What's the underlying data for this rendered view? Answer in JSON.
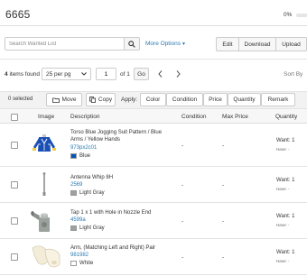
{
  "header": {
    "title": "6665",
    "progress_label": "0%",
    "progress_fraction": 0
  },
  "search": {
    "placeholder": "Search Wanted List",
    "more_options_label": "More Options"
  },
  "actions": {
    "edit_label": "Edit",
    "download_label": "Download",
    "upload_label": "Upload"
  },
  "pagination": {
    "items_found_count": "4",
    "items_found_text": "items found",
    "per_page_label": "25 per pg",
    "page_value": "1",
    "of_pages_label": "of 1",
    "go_label": "Go",
    "sort_by_label": "Sort By"
  },
  "toolbar": {
    "selected_label": "0 selected",
    "move_label": "Move",
    "copy_label": "Copy",
    "apply_label": "Apply:",
    "color_label": "Color",
    "condition_label": "Condition",
    "price_label": "Price",
    "quantity_label": "Quantity",
    "remark_label": "Remark"
  },
  "table": {
    "headers": {
      "image": "Image",
      "description": "Description",
      "condition": "Condition",
      "max_price": "Max Price",
      "quantity": "Quantity"
    },
    "rows": [
      {
        "description": "Torso Blue Jogging Suit Pattern / Blue Arms / Yellow Hands",
        "item_no": "973px2c01",
        "color_name": "Blue",
        "color_hex": "#0055bf",
        "condition": "-",
        "max_price": "-",
        "want": "Want: 1",
        "have": "Have: -",
        "image_icon": "torso-icon"
      },
      {
        "description": "Antenna Whip 8H",
        "item_no": "2569",
        "color_name": "Light Gray",
        "color_hex": "#9ba19d",
        "condition": "-",
        "max_price": "-",
        "want": "Want: 1",
        "have": "Have: -",
        "image_icon": "antenna-icon"
      },
      {
        "description": "Tap 1 x 1 with Hole in Nozzle End",
        "item_no": "4599a",
        "color_name": "Light Gray",
        "color_hex": "#9ba19d",
        "condition": "-",
        "max_price": "-",
        "want": "Want: 1",
        "have": "Have: -",
        "image_icon": "tap-icon"
      },
      {
        "description": "Arm, (Matching Left and Right) Pair",
        "item_no": "981982",
        "color_name": "White",
        "color_hex": "#ffffff",
        "condition": "-",
        "max_price": "-",
        "want": "Want: 1",
        "have": "Have: -",
        "image_icon": "arm-icon"
      }
    ]
  }
}
